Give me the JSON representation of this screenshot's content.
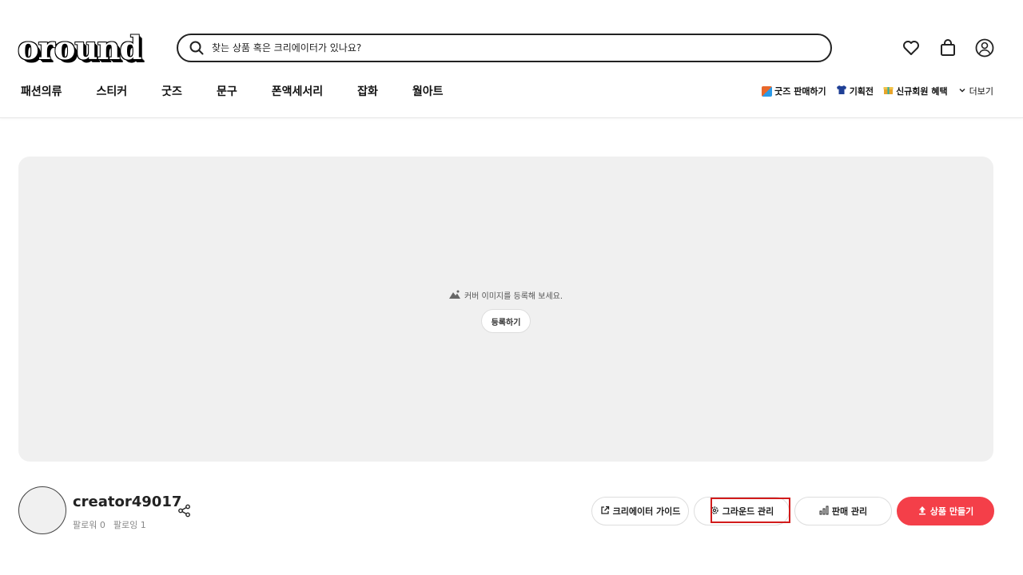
{
  "header": {
    "logo_text": "oround",
    "search": {
      "placeholder": "찾는 상품 혹은 크리에이터가 있나요?",
      "value": ""
    },
    "icons": [
      "heart-icon",
      "shopping-bag-icon",
      "user-profile-icon"
    ]
  },
  "nav": {
    "categories": [
      "패션의류",
      "스티커",
      "굿즈",
      "문구",
      "폰액세서리",
      "잡화",
      "월아트"
    ],
    "utility": [
      {
        "label": "굿즈 판매하기",
        "icon": "goods-icon",
        "color": "#e8682b"
      },
      {
        "label": "기획전",
        "icon": "tshirt-icon",
        "color": "#1f3f95"
      },
      {
        "label": "신규회원 혜택",
        "icon": "gift-icon",
        "color": "#e8a52b"
      },
      {
        "label": "더보기",
        "icon": "chevron-down-icon"
      }
    ]
  },
  "cover": {
    "message": "커버 이미지를 등록해 보세요.",
    "register_label": "등록하기"
  },
  "profile": {
    "name": "creator49017",
    "followers_label": "팔로워",
    "followers_count": "0",
    "following_label": "팔로잉",
    "following_count": "1"
  },
  "actions": {
    "guide_label": "크리에이터 가이드",
    "ground_label": "그라운드 관리",
    "sales_label": "판매 관리",
    "make_label": "상품 만들기"
  },
  "colors": {
    "accent": "#f43f49",
    "highlight": "#d21b1b",
    "cover_bg": "#f0f0f0"
  }
}
